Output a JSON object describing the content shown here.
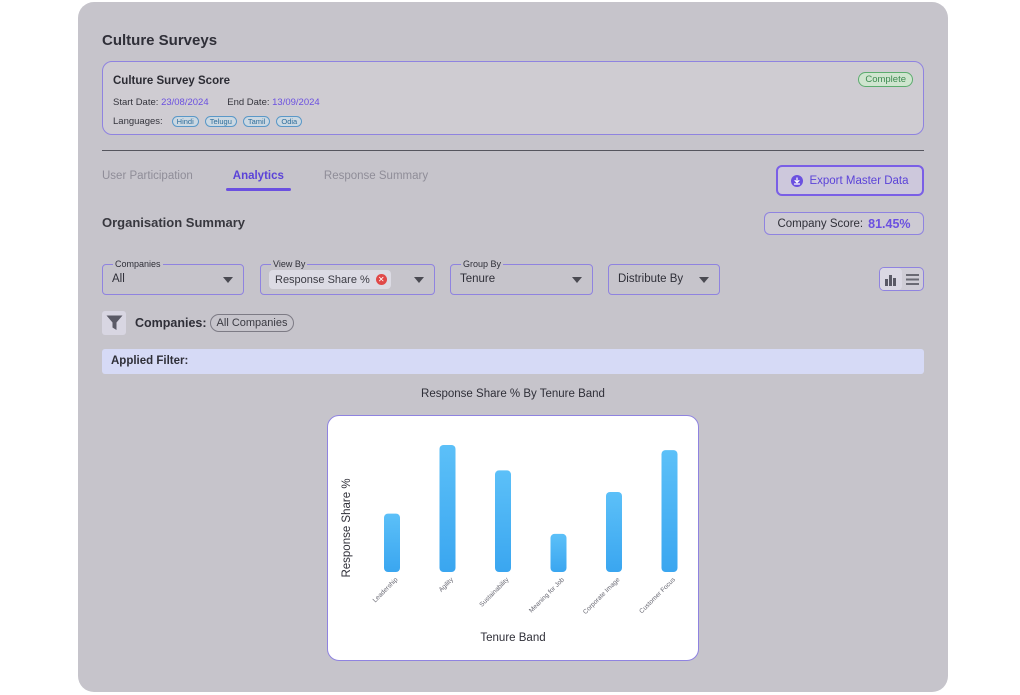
{
  "page": {
    "title": "Culture Surveys"
  },
  "survey_card": {
    "title": "Culture Survey Score",
    "status": "Complete",
    "start_label": "Start Date:",
    "start_date": "23/08/2024",
    "end_label": "End Date:",
    "end_date": "13/09/2024",
    "languages_label": "Languages:",
    "languages": [
      "Hindi",
      "Telugu",
      "Tamil",
      "Odia"
    ]
  },
  "tabs": [
    {
      "label": "User Participation",
      "active": false
    },
    {
      "label": "Analytics",
      "active": true
    },
    {
      "label": "Response Summary",
      "active": false
    }
  ],
  "export_button": {
    "label": "Export Master Data",
    "icon": "download-icon"
  },
  "summary": {
    "title": "Organisation Summary",
    "company_score_label": "Company Score:",
    "company_score_value": "81.45%"
  },
  "filters": {
    "companies": {
      "label": "Companies",
      "value": "All"
    },
    "view_by": {
      "label": "View By",
      "value": "Response Share %"
    },
    "group_by": {
      "label": "Group By",
      "value": "Tenure"
    },
    "distribute_by": {
      "value": "Distribute By"
    }
  },
  "view_toggle": {
    "icons": [
      "bar-chart-icon",
      "list-icon"
    ],
    "active": "bar-chart-icon"
  },
  "company_filter": {
    "label": "Companies:",
    "chip": "All Companies"
  },
  "applied_filter": {
    "label": "Applied Filter:"
  },
  "chart_data": {
    "type": "bar",
    "title": "Response Share % By Tenure Band",
    "xlabel": "Tenure Band",
    "ylabel": "Response Share %",
    "categories": [
      "Leadership",
      "Agility",
      "Sustainability",
      "Meaning for Job",
      "Corporate Image",
      "Customer Focus"
    ],
    "values": [
      46,
      100,
      80,
      30,
      63,
      96
    ],
    "ylim": [
      0,
      100
    ],
    "grid": false,
    "bar_color": "#55b8f5"
  },
  "colors": {
    "accent": "#6b50e0",
    "panel": "#c6c4cb",
    "status_complete": "#3f8b52",
    "remove": "#e04848"
  }
}
